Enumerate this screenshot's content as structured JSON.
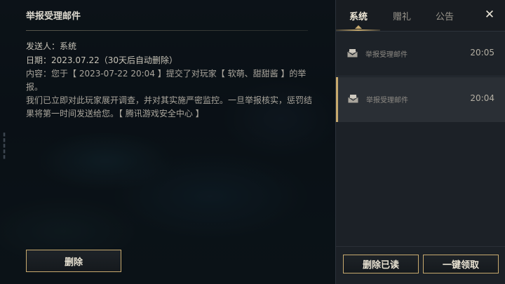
{
  "mail": {
    "title": "举报受理邮件",
    "sender_label": "发送人：",
    "sender": "系统",
    "date_label": "日期：",
    "date": "2023.07.22",
    "expiry": "（30天后自动删除）",
    "content_line1": "内容：您于【 2023-07-22 20:04 】提交了对玩家【 软萌、甜甜酱 】的举报。",
    "content_line2": "我们已立即对此玩家展开调查，并对其实施严密监控。一旦举报核实，惩罚结",
    "content_line3": "果将第一时间发送给您。【 腾讯游戏安全中心 】",
    "delete_label": "删除"
  },
  "tabs": [
    {
      "label": "系统",
      "active": true
    },
    {
      "label": "赠礼",
      "active": false
    },
    {
      "label": "公告",
      "active": false
    }
  ],
  "close_label": "✕",
  "inbox": [
    {
      "icon": "envelope-icon",
      "subject": "举报受理邮件",
      "time": "20:05",
      "selected": false
    },
    {
      "icon": "envelope-icon",
      "subject": "举报受理邮件",
      "time": "20:04",
      "selected": true
    }
  ],
  "footer": {
    "clear_read_label": "删除已读",
    "claim_all_label": "一键领取"
  },
  "colors": {
    "accent_gold": "#c8aa6e",
    "panel_bg": "#1c2127",
    "selected_bg": "#2a2f35"
  }
}
